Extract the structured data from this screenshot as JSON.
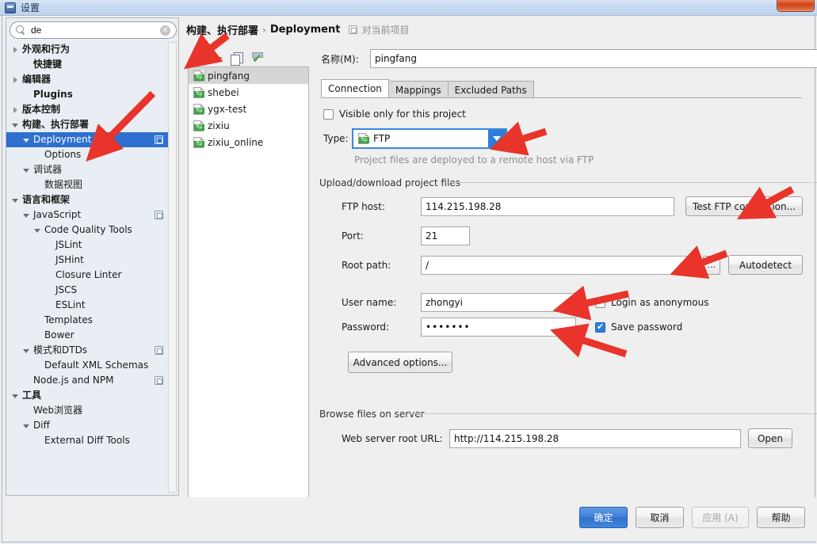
{
  "window": {
    "title": "设置",
    "icon": "settings-window-icon",
    "close_label": ""
  },
  "sidebar": {
    "search": {
      "value": "de",
      "placeholder": "",
      "icon": "search-icon",
      "clear_icon": "clear-icon"
    },
    "items": [
      {
        "label": "外观和行为",
        "indent": 0,
        "arrow": "closed",
        "bold": true,
        "selected": false,
        "scope": false
      },
      {
        "label": "快捷键",
        "indent": 1,
        "arrow": "none",
        "bold": true,
        "selected": false,
        "scope": false
      },
      {
        "label": "编辑器",
        "indent": 0,
        "arrow": "closed",
        "bold": true,
        "selected": false,
        "scope": false
      },
      {
        "label": "Plugins",
        "indent": 1,
        "arrow": "none",
        "bold": true,
        "selected": false,
        "scope": false
      },
      {
        "label": "版本控制",
        "indent": 0,
        "arrow": "closed",
        "bold": true,
        "selected": false,
        "scope": false
      },
      {
        "label": "构建、执行部署",
        "indent": 0,
        "arrow": "open",
        "bold": true,
        "selected": false,
        "scope": false
      },
      {
        "label": "Deployment",
        "indent": 1,
        "arrow": "open",
        "bold": false,
        "selected": true,
        "scope": true
      },
      {
        "label": "Options",
        "indent": 2,
        "arrow": "none",
        "bold": false,
        "selected": false,
        "scope": false
      },
      {
        "label": "调试器",
        "indent": 1,
        "arrow": "open",
        "bold": false,
        "selected": false,
        "scope": false
      },
      {
        "label": "数据视图",
        "indent": 2,
        "arrow": "none",
        "bold": false,
        "selected": false,
        "scope": false
      },
      {
        "label": "语言和框架",
        "indent": 0,
        "arrow": "open",
        "bold": true,
        "selected": false,
        "scope": false
      },
      {
        "label": "JavaScript",
        "indent": 1,
        "arrow": "open",
        "bold": false,
        "selected": false,
        "scope": true
      },
      {
        "label": "Code Quality Tools",
        "indent": 2,
        "arrow": "open",
        "bold": false,
        "selected": false,
        "scope": false
      },
      {
        "label": "JSLint",
        "indent": 3,
        "arrow": "none",
        "bold": false,
        "selected": false,
        "scope": false
      },
      {
        "label": "JSHint",
        "indent": 3,
        "arrow": "none",
        "bold": false,
        "selected": false,
        "scope": false
      },
      {
        "label": "Closure Linter",
        "indent": 3,
        "arrow": "none",
        "bold": false,
        "selected": false,
        "scope": false
      },
      {
        "label": "JSCS",
        "indent": 3,
        "arrow": "none",
        "bold": false,
        "selected": false,
        "scope": false
      },
      {
        "label": "ESLint",
        "indent": 3,
        "arrow": "none",
        "bold": false,
        "selected": false,
        "scope": false
      },
      {
        "label": "Templates",
        "indent": 2,
        "arrow": "none",
        "bold": false,
        "selected": false,
        "scope": false
      },
      {
        "label": "Bower",
        "indent": 2,
        "arrow": "none",
        "bold": false,
        "selected": false,
        "scope": false
      },
      {
        "label": "模式和DTDs",
        "indent": 1,
        "arrow": "open",
        "bold": false,
        "selected": false,
        "scope": true
      },
      {
        "label": "Default XML Schemas",
        "indent": 2,
        "arrow": "none",
        "bold": false,
        "selected": false,
        "scope": false
      },
      {
        "label": "Node.js and NPM",
        "indent": 1,
        "arrow": "none",
        "bold": false,
        "selected": false,
        "scope": true
      },
      {
        "label": "工具",
        "indent": 0,
        "arrow": "open",
        "bold": true,
        "selected": false,
        "scope": false
      },
      {
        "label": "Web浏览器",
        "indent": 1,
        "arrow": "none",
        "bold": false,
        "selected": false,
        "scope": false
      },
      {
        "label": "Diff",
        "indent": 1,
        "arrow": "open",
        "bold": false,
        "selected": false,
        "scope": false
      },
      {
        "label": "External Diff Tools",
        "indent": 2,
        "arrow": "none",
        "bold": false,
        "selected": false,
        "scope": false
      }
    ]
  },
  "breadcrumb": {
    "parent": "构建、执行部署",
    "separator": "›",
    "current": "Deployment",
    "scope_icon": "project-scope-icon",
    "scope_note": "对当前项目"
  },
  "server_toolbar": {
    "add_icon": "plus-icon",
    "remove_icon": "minus-icon",
    "copy_icon": "copy-icon",
    "default_icon": "set-default-check-icon"
  },
  "server_list": {
    "items": [
      {
        "label": "pingfang",
        "icon": "ftp-icon",
        "selected": true
      },
      {
        "label": "shebei",
        "icon": "ftp-icon",
        "selected": false
      },
      {
        "label": "ygx-test",
        "icon": "ftp-icon",
        "selected": false
      },
      {
        "label": "zixiu",
        "icon": "ftp-icon",
        "selected": false
      },
      {
        "label": "zixiu_online",
        "icon": "ftp-icon",
        "selected": false
      }
    ]
  },
  "form": {
    "name_label": "名称(M):",
    "name_value": "pingfang",
    "tabs": [
      {
        "label": "Connection",
        "active": true
      },
      {
        "label": "Mappings",
        "active": false
      },
      {
        "label": "Excluded Paths",
        "active": false
      }
    ],
    "visible_only_label": "Visible only for this project",
    "visible_only_checked": false,
    "type_label": "Type:",
    "type_value": "FTP",
    "type_icon": "ftp-icon",
    "type_hint": "Project files are deployed to a remote host via FTP",
    "upload_group_title": "Upload/download project files",
    "ftp_host_label": "FTP host:",
    "ftp_host_value": "114.215.198.28",
    "test_connection_label": "Test FTP connection...",
    "port_label": "Port:",
    "port_value": "21",
    "root_path_label": "Root path:",
    "root_path_value": "/",
    "browse_dots_label": "...",
    "autodetect_label": "Autodetect",
    "username_label": "User name:",
    "username_value": "zhongyi",
    "anonymous_label": "Login as anonymous",
    "anonymous_checked": false,
    "password_label": "Password:",
    "password_value": "•••••••",
    "save_password_label": "Save password",
    "save_password_checked": true,
    "advanced_options_label": "Advanced options...",
    "browse_group_title": "Browse files on server",
    "web_root_label": "Web server root URL:",
    "web_root_value": "http://114.215.198.28",
    "open_label": "Open"
  },
  "footer": {
    "ok_label": "确定",
    "cancel_label": "取消",
    "apply_label": "应用 (A)",
    "help_label": "帮助"
  },
  "colors": {
    "selection_blue": "#2f6fd0",
    "accent_blue": "#2f7cdc",
    "annotation_red": "#e8342a",
    "add_green": "#2e9b3e",
    "remove_red": "#d8605c"
  }
}
